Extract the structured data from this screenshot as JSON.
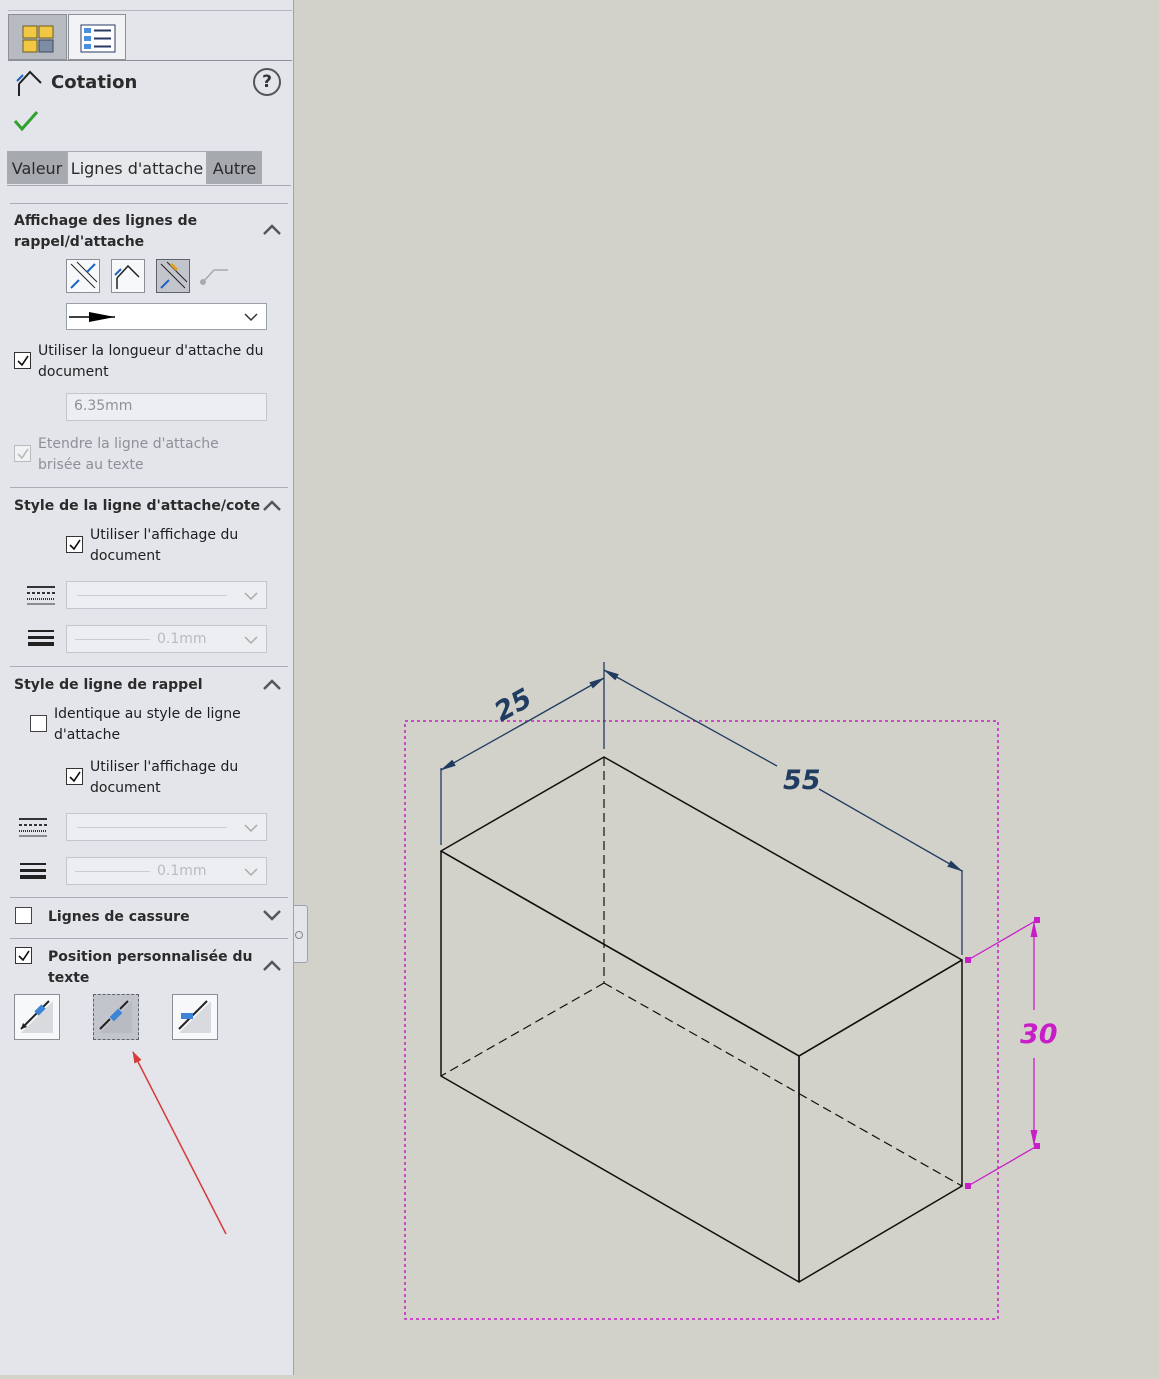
{
  "panel": {
    "title": "Cotation",
    "tabs": [
      "Valeur",
      "Lignes d'attache",
      "Autre"
    ],
    "section_leader": {
      "title": "Affichage des lignes de rappel/d'attache",
      "use_doc_length_label": "Utiliser la longueur d'attache du document",
      "use_doc_length_checked": true,
      "length_value": "6.35mm",
      "extend_label": "Etendre la ligne d'attache brisée au texte",
      "extend_checked": true
    },
    "section_style": {
      "title": "Style de la ligne d'attache/cote",
      "use_doc_display_label": "Utiliser l'affichage du document",
      "thickness_value": "0.1mm"
    },
    "section_ext": {
      "title": "Style de ligne de rappel",
      "same_style_label": "Identique au style de ligne d'attache",
      "same_style_checked": false,
      "use_doc_display_label": "Utiliser l'affichage du document",
      "thickness_value": "0.1mm"
    },
    "section_break": {
      "title": "Lignes de cassure",
      "checked": false
    },
    "section_textpos": {
      "title": "Position personnalisée du texte",
      "checked": true,
      "active_option_index": 1
    }
  },
  "drawing": {
    "dimensions": [
      "25",
      "55",
      "30"
    ],
    "selected_dimension": "30",
    "dimension_color": "#203c60",
    "selected_color": "#c81ec8",
    "annotation_arrow_color": "#d83a3a"
  }
}
